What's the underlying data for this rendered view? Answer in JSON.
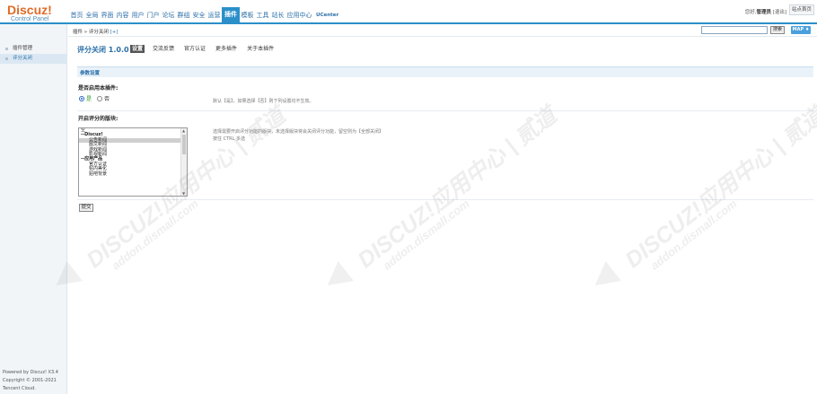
{
  "logo": {
    "main": "Discuz!",
    "sub": "Control Panel"
  },
  "topnav": {
    "items": [
      "首页",
      "全局",
      "界面",
      "内容",
      "用户",
      "门户",
      "论坛",
      "群组",
      "安全",
      "运营",
      "插件",
      "模板",
      "工具",
      "站长",
      "应用中心",
      "UCenter"
    ],
    "active_index": 10
  },
  "userbar": {
    "greeting": "您好,",
    "username": "管理员",
    "logout": "[退出]",
    "home": "站点首页"
  },
  "sidebar": {
    "items": [
      {
        "label": "插件管理"
      },
      {
        "label": "评分关闭"
      }
    ],
    "active_index": 1,
    "footer": [
      "Powered by Discuz! X3.4",
      "Copyright © 2001-2021",
      "Tencent Cloud."
    ]
  },
  "breadcrumb": {
    "path": "插件 » 评分关闭",
    "add": "[+]"
  },
  "search": {
    "value": "",
    "button": "搜索",
    "map": "MAP ♦"
  },
  "plugin": {
    "title": "评分关闭 1.0.0",
    "tabs": [
      "设置",
      "交流反馈",
      "官方认证",
      "更多插件",
      "关于本插件"
    ],
    "active_tab": 0
  },
  "settings": {
    "section_title": "参数设置",
    "enable": {
      "label": "是否启用本插件:",
      "yes": "是",
      "no": "否",
      "selected": "yes",
      "tip": "默认【是】，如果选择【否】则下列设置均不生效。"
    },
    "forums": {
      "label": "开启评分的版块:",
      "options": [
        {
          "text": "空",
          "indent": 0,
          "group": false,
          "selected": false
        },
        {
          "text": "--Discuz!",
          "indent": 0,
          "group": true,
          "selected": false
        },
        {
          "text": "公告新闻",
          "indent": 1,
          "group": false,
          "selected": true
        },
        {
          "text": "图文新闻",
          "indent": 1,
          "group": false,
          "selected": false
        },
        {
          "text": "游戏新闻",
          "indent": 1,
          "group": false,
          "selected": false
        },
        {
          "text": "影视新闻",
          "indent": 1,
          "group": false,
          "selected": false
        },
        {
          "text": "--应用产品",
          "indent": 0,
          "group": true,
          "selected": false
        },
        {
          "text": "官方认证",
          "indent": 1,
          "group": false,
          "selected": false
        },
        {
          "text": "帖内美化",
          "indent": 1,
          "group": false,
          "selected": false
        },
        {
          "text": "贴吧背景",
          "indent": 1,
          "group": false,
          "selected": false
        }
      ],
      "tip_line1": "选择需要开启评分功能的版块，未选择版块将会关闭评分功能，留空则为【全部关闭】",
      "tip_line2": "按住 CTRL 多选"
    },
    "submit": "提交"
  },
  "watermark": {
    "line1": "DISCUZ!应用中心 | 贰道",
    "line2": "addon.dismall.com"
  },
  "colors": {
    "accent": "#2b8fc9",
    "logo": "#e06b25",
    "link": "#2b6fa8"
  }
}
